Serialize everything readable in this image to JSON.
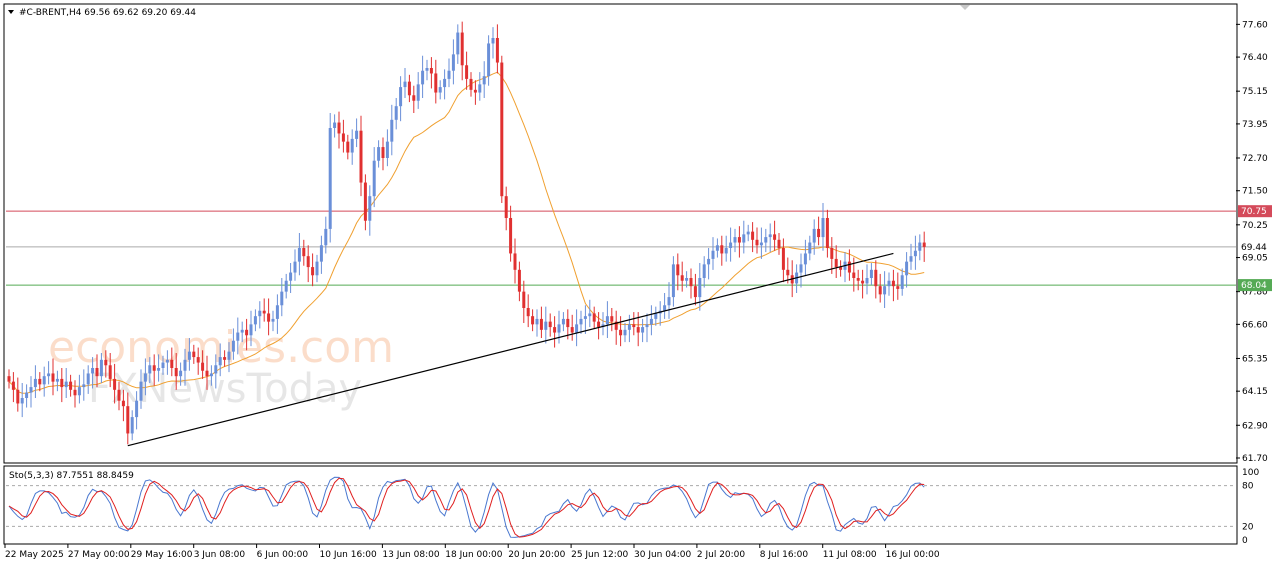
{
  "header": {
    "symbol_line": "#C-BRENT,H4  69.56 69.62 69.20 69.44",
    "stoch_line": "Sto(5,3,3) 87.7551 88.8459"
  },
  "watermark": {
    "brand": "economies.com",
    "sub": "FXNewsToday"
  },
  "colors": {
    "bull": "#6a8fd8",
    "bear": "#e03030",
    "ma": "#f0a030",
    "resistance": "#d44a5a",
    "support": "#55aa55",
    "trend": "#000000",
    "current": "#aaaaaa",
    "stoch_main": "#4a78d0",
    "stoch_signal": "#e02020"
  },
  "chart_data": {
    "type": "candlestick",
    "ylim": [
      61.7,
      78.2
    ],
    "y_ticks": [
      "77.60",
      "76.40",
      "75.15",
      "73.95",
      "72.70",
      "71.50",
      "70.25",
      "69.05",
      "67.80",
      "66.60",
      "65.35",
      "64.15",
      "62.90",
      "61.70"
    ],
    "x_tick_labels": [
      "22 May 2025",
      "27 May 00:00",
      "29 May 16:00",
      "3 Jun 08:00",
      "6 Jun 00:00",
      "10 Jun 16:00",
      "13 Jun 08:00",
      "18 Jun 00:00",
      "20 Jun 20:00",
      "25 Jun 12:00",
      "30 Jun 04:00",
      "2 Jul 20:00",
      "8 Jul 16:00",
      "11 Jul 08:00",
      "16 Jul 00:00"
    ],
    "levels": {
      "resistance": "70.75",
      "current": "69.44",
      "support": "68.04"
    },
    "trendline": {
      "from": {
        "bar": 27,
        "price": 62.15
      },
      "to": {
        "bar": 201,
        "price": 69.2
      }
    },
    "closes": [
      64.5,
      64.2,
      63.7,
      63.9,
      64.1,
      64.3,
      64.6,
      64.4,
      64.7,
      64.8,
      64.5,
      64.6,
      64.3,
      64.5,
      64.2,
      64.0,
      64.3,
      64.4,
      64.8,
      65.0,
      64.7,
      65.3,
      65.1,
      64.6,
      64.2,
      63.8,
      63.6,
      62.6,
      63.2,
      63.8,
      64.5,
      64.8,
      65.1,
      64.9,
      65.0,
      65.2,
      65.3,
      65.0,
      64.7,
      64.9,
      65.3,
      65.6,
      65.4,
      65.2,
      64.9,
      64.7,
      64.8,
      65.1,
      65.4,
      65.3,
      65.6,
      66.0,
      66.3,
      66.4,
      66.2,
      66.6,
      66.9,
      67.1,
      67.0,
      66.7,
      66.8,
      67.3,
      67.8,
      68.2,
      68.5,
      68.9,
      69.4,
      69.1,
      68.7,
      68.4,
      68.9,
      69.5,
      70.1,
      73.8,
      74.0,
      73.6,
      73.3,
      72.9,
      73.4,
      73.7,
      71.8,
      70.4,
      71.3,
      72.6,
      73.1,
      72.7,
      73.3,
      74.1,
      74.6,
      75.3,
      75.5,
      75.0,
      74.8,
      75.4,
      75.9,
      76.0,
      75.8,
      75.1,
      75.3,
      75.6,
      75.9,
      76.5,
      77.3,
      76.1,
      75.6,
      75.2,
      75.1,
      75.4,
      75.7,
      76.9,
      77.1,
      76.2,
      71.3,
      70.5,
      69.2,
      68.6,
      67.8,
      67.2,
      66.9,
      66.6,
      66.8,
      66.4,
      66.7,
      66.5,
      66.3,
      66.6,
      66.8,
      66.5,
      66.3,
      66.6,
      66.8,
      66.9,
      67.0,
      66.7,
      66.5,
      66.6,
      66.9,
      66.7,
      66.4,
      66.2,
      66.4,
      66.6,
      66.5,
      66.3,
      66.5,
      66.6,
      66.8,
      67.0,
      67.1,
      67.3,
      67.6,
      68.8,
      68.4,
      68.2,
      68.3,
      68.0,
      67.6,
      68.3,
      68.8,
      69.0,
      69.3,
      69.5,
      69.2,
      69.4,
      69.6,
      69.8,
      69.6,
      69.9,
      70.0,
      69.7,
      69.5,
      69.6,
      69.8,
      69.9,
      69.7,
      69.4,
      68.6,
      68.4,
      68.1,
      68.5,
      68.8,
      69.2,
      69.6,
      70.1,
      69.8,
      70.5,
      69.4,
      69.0,
      68.7,
      68.6,
      68.9,
      68.5,
      68.3,
      68.2,
      68.1,
      68.3,
      68.6,
      68.0,
      67.7,
      68.0,
      68.2,
      68.0,
      67.9,
      68.4,
      68.9,
      69.1,
      69.3,
      69.6,
      69.44
    ],
    "stochastic": {
      "main_value": "87.7551",
      "signal_value": "88.8459",
      "levels": [
        "100",
        "80",
        "20",
        "0"
      ]
    }
  }
}
